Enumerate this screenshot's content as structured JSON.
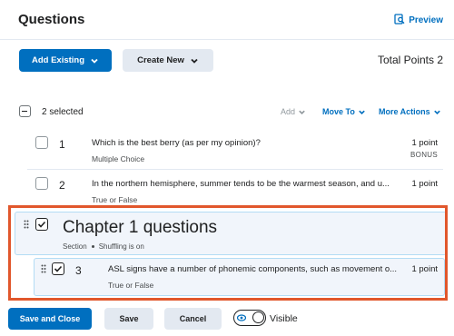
{
  "header": {
    "title": "Questions",
    "preview_label": "Preview"
  },
  "actions": {
    "add_existing": "Add Existing",
    "create_new": "Create New",
    "total_points": "Total Points 2"
  },
  "toolbar": {
    "selected_count": "2 selected",
    "add": "Add",
    "move_to": "Move To",
    "more_actions": "More Actions"
  },
  "questions": [
    {
      "number": "1",
      "title": "Which is the best berry (as per my opinion)?",
      "type": "Multiple Choice",
      "points": "1 point",
      "bonus": "BONUS"
    },
    {
      "number": "2",
      "title": "In the northern hemisphere, summer tends to be the warmest season, and u...",
      "type": "True or False",
      "points": "1 point"
    }
  ],
  "section": {
    "title": "Chapter 1 questions",
    "label": "Section",
    "shuffle": "Shuffling is on"
  },
  "section_question": {
    "number": "3",
    "title": "ASL signs have a number of phonemic components, such as movement o...",
    "type": "True or False",
    "points": "1 point"
  },
  "footer": {
    "save_close": "Save and Close",
    "save": "Save",
    "cancel": "Cancel",
    "visibility": "Visible"
  },
  "colors": {
    "primary": "#006fbf",
    "highlight": "#e1572c",
    "section_bg": "#f1f5fb"
  }
}
